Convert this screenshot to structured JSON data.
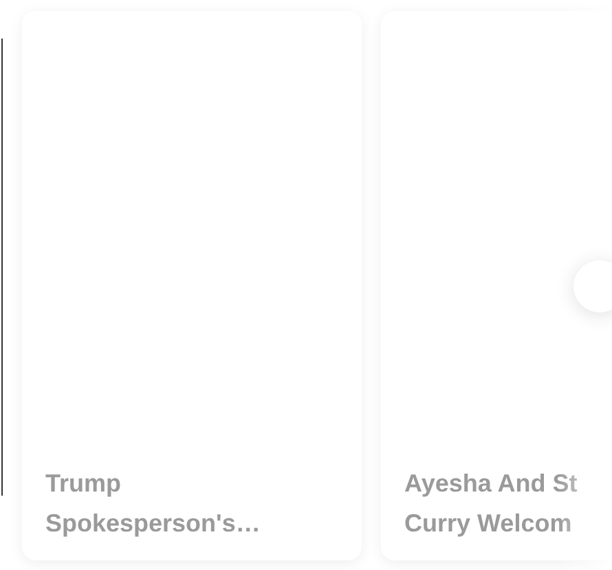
{
  "cards": [
    {
      "title_lines": [
        "Trump",
        "Spokesperson's…"
      ]
    },
    {
      "title_lines": [
        "Ayesha And St",
        "Curry Welcom"
      ]
    }
  ]
}
